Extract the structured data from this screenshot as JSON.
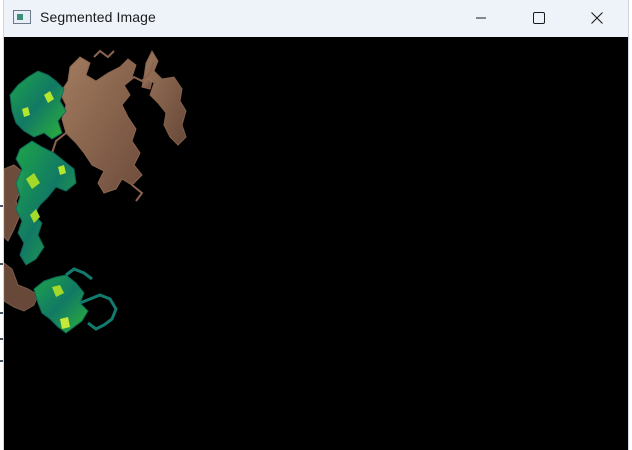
{
  "window": {
    "title": "Segmented Image",
    "app_icon": "window-app-icon",
    "controls": {
      "minimize_icon": "minimize-icon",
      "maximize_icon": "maximize-icon",
      "close_icon": "close-icon"
    }
  },
  "canvas": {
    "background": "#000000",
    "segment_colors": {
      "brown": "#8a6450",
      "light_brown": "#b58a6a",
      "green": "#1f9a4a",
      "teal": "#137a6e",
      "lime": "#a4d92a"
    }
  }
}
